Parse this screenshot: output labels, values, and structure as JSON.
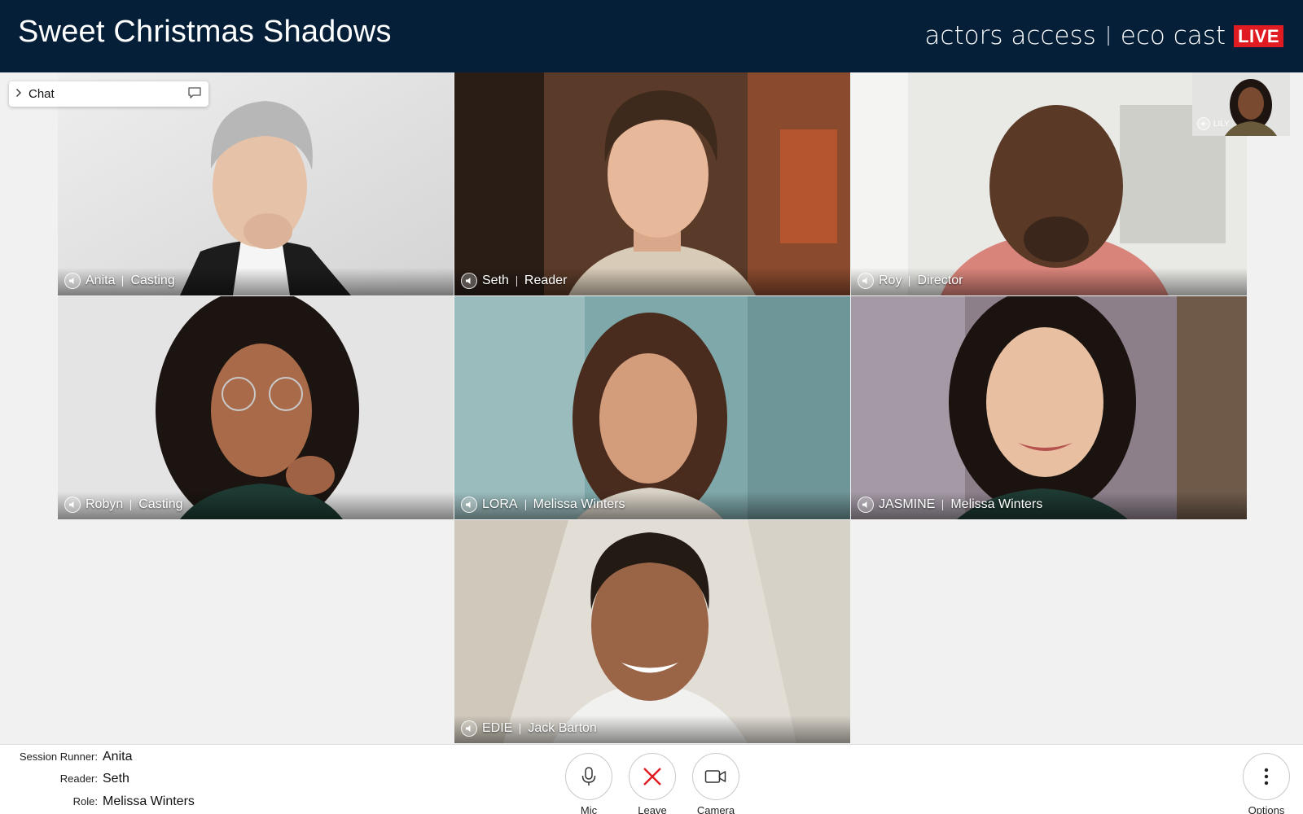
{
  "header": {
    "session_title": "Sweet Christmas Shadows",
    "brand_left": "actors access",
    "brand_right": "eco cast",
    "live_badge": "LIVE"
  },
  "chat": {
    "label": "Chat"
  },
  "self_view": {
    "name": "LILY"
  },
  "tiles": [
    {
      "name": "Anita",
      "role": "Casting"
    },
    {
      "name": "Seth",
      "role": "Reader"
    },
    {
      "name": "Roy",
      "role": "Director"
    },
    {
      "name": "Robyn",
      "role": "Casting"
    },
    {
      "name": "LORA",
      "role": "Melissa Winters"
    },
    {
      "name": "JASMINE",
      "role": "Melissa Winters"
    },
    {
      "name": "EDIE",
      "role": "Jack Barton"
    }
  ],
  "footer": {
    "session_runner_key": "Session Runner:",
    "session_runner_val": "Anita",
    "reader_key": "Reader:",
    "reader_val": "Seth",
    "role_key": "Role:",
    "role_val": "Melissa Winters",
    "mic_label": "Mic",
    "leave_label": "Leave",
    "camera_label": "Camera",
    "options_label": "Options"
  },
  "colors": {
    "header_bg": "#051f38",
    "live_red": "#e01b22",
    "leave_red": "#e01b22"
  }
}
